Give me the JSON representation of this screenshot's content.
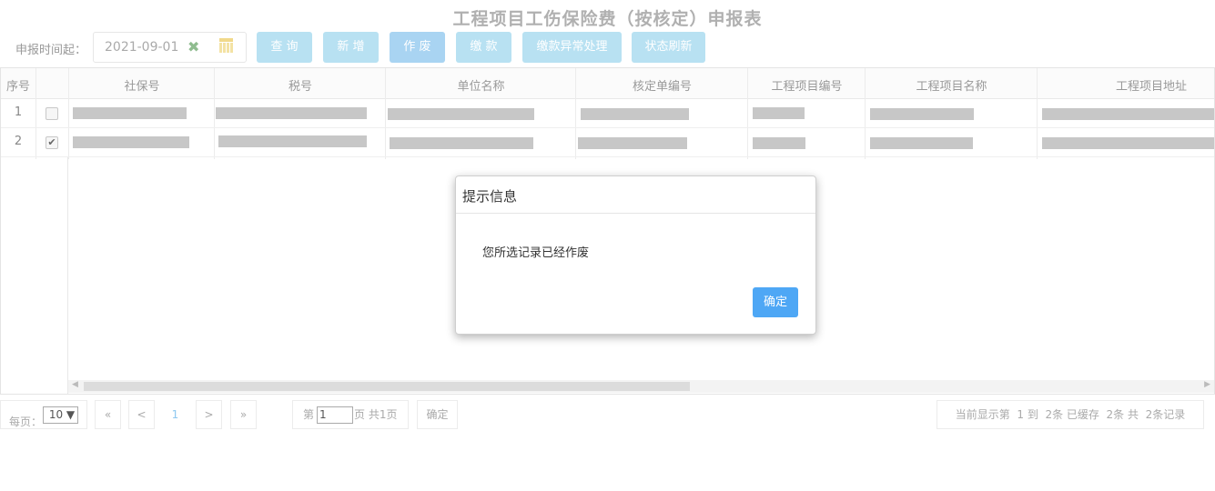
{
  "title": "工程项目工伤保险费（按核定）申报表",
  "toolbar": {
    "date_label": "申报时间起：",
    "date_value": "2021-09-01",
    "buttons": {
      "query": "查 询",
      "add": "新 增",
      "void": "作 废",
      "pay": "缴 款",
      "pay_exception": "缴款异常处理",
      "refresh_status": "状态刷新"
    }
  },
  "table": {
    "columns": [
      "序号",
      "社保号",
      "税号",
      "单位名称",
      "核定单编号",
      "工程项目编号",
      "工程项目名称",
      "工程项目地址"
    ],
    "rows": [
      {
        "num": "1",
        "checked": false
      },
      {
        "num": "2",
        "checked": true
      }
    ]
  },
  "pager": {
    "per_page_label": "每页：",
    "per_page_value": "10 ▼",
    "first": "«",
    "prev": "<",
    "current": "1",
    "next": ">",
    "last": "»",
    "page_prefix": "第",
    "page_input": "1",
    "page_suffix": "页 共1页",
    "go": "确定",
    "summary": "当前显示第  1 到  2条 已缓存  2条 共  2条记录"
  },
  "dialog": {
    "title": "提示信息",
    "message": "您所选记录已经作废",
    "ok": "确定"
  }
}
